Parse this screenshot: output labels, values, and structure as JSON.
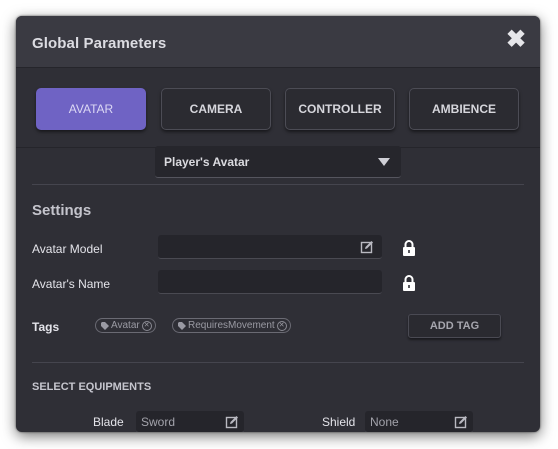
{
  "window": {
    "title": "Global Parameters",
    "close_glyph": "✖"
  },
  "tabs": [
    {
      "label": "AVATAR",
      "active": true
    },
    {
      "label": "CAMERA",
      "active": false
    },
    {
      "label": "CONTROLLER",
      "active": false
    },
    {
      "label": "AMBIENCE",
      "active": false
    }
  ],
  "profile_select": {
    "value": "Player's Avatar"
  },
  "settings": {
    "title": "Settings",
    "avatar_model": {
      "label": "Avatar Model",
      "value": ""
    },
    "avatar_name": {
      "label": "Avatar's Name",
      "value": ""
    },
    "tags": {
      "label": "Tags",
      "items": [
        "Avatar",
        "RequiresMovement"
      ],
      "add_label": "ADD TAG"
    }
  },
  "equipment": {
    "title": "SELECT EQUIPMENTS",
    "blade": {
      "label": "Blade",
      "value": "Sword"
    },
    "shield": {
      "label": "Shield",
      "value": "None"
    }
  },
  "colors": {
    "panel": "#2f2f36",
    "accent": "#6f63c4",
    "field": "#25252b"
  },
  "icons": [
    "close-icon",
    "chevron-down-icon",
    "edit-icon",
    "lock-icon",
    "tag-icon",
    "remove-tag-icon"
  ]
}
